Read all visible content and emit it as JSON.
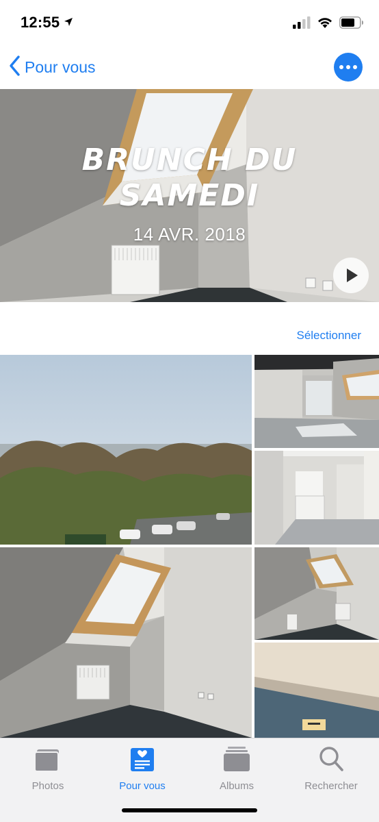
{
  "status_bar": {
    "time": "12:55",
    "location_icon": "location-arrow-icon",
    "signal_icon": "cellular-signal-icon",
    "wifi_icon": "wifi-icon",
    "battery_icon": "battery-icon"
  },
  "nav": {
    "back_label": "Pour vous",
    "back_icon": "chevron-left-icon",
    "more_icon": "ellipsis-icon"
  },
  "memory": {
    "title_line1": "BRUNCH DU",
    "title_line2": "SAMEDI",
    "date": "14 AVR. 2018",
    "play_icon": "play-icon"
  },
  "select_label": "Sélectionner",
  "tabs": [
    {
      "label": "Photos",
      "icon": "photos-icon",
      "active": false
    },
    {
      "label": "Pour vous",
      "icon": "for-you-icon",
      "active": true
    },
    {
      "label": "Albums",
      "icon": "albums-icon",
      "active": false
    },
    {
      "label": "Rechercher",
      "icon": "search-icon",
      "active": false
    }
  ],
  "colors": {
    "accent": "#1f7ef0",
    "tab_inactive": "#8e8e93",
    "tab_bar_bg": "#f2f2f3"
  }
}
